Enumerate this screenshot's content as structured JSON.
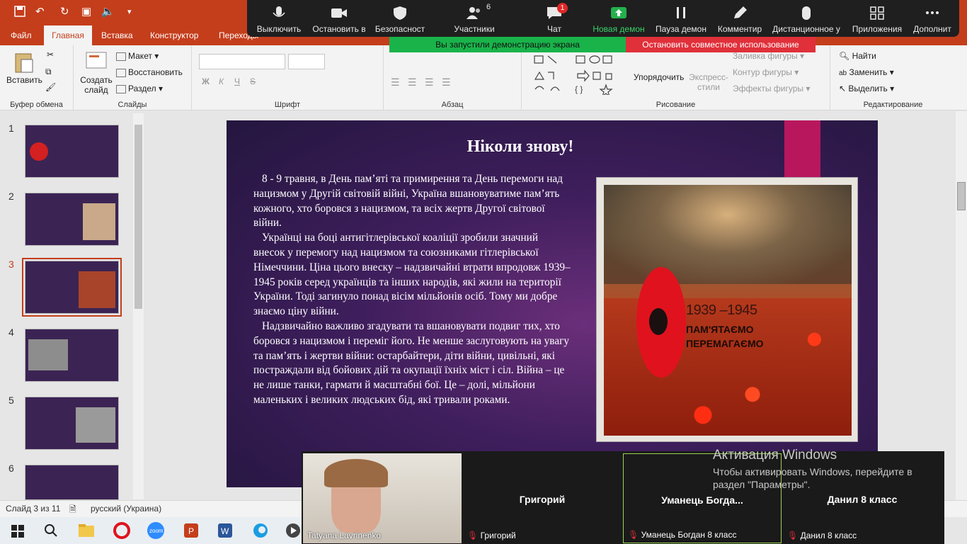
{
  "titlebar": {
    "save_icon": "save-icon",
    "undo_icon": "undo-icon"
  },
  "tabs": [
    {
      "label": "Файл"
    },
    {
      "label": "Главная"
    },
    {
      "label": "Вставка"
    },
    {
      "label": "Конструктор"
    },
    {
      "label": "Переходы"
    }
  ],
  "ribbon": {
    "clipboard": {
      "paste": "Вставить",
      "label": "Буфер обмена"
    },
    "slides": {
      "new_slide": "Создать слайд",
      "layout": "Макет",
      "reset": "Восстановить",
      "section": "Раздел",
      "label": "Слайды"
    },
    "font": {
      "label": "Шрифт",
      "bold": "Ж",
      "italic": "К",
      "underline": "Ч",
      "strike": "S"
    },
    "paragraph": {
      "label": "Абзац"
    },
    "drawing": {
      "arrange": "Упорядочить",
      "quick_styles": "Экспресс-стили",
      "fill": "Заливка фигуры",
      "outline": "Контур фигуры",
      "effects": "Эффекты фигуры",
      "label": "Рисование"
    },
    "editing": {
      "find": "Найти",
      "replace": "Заменить",
      "select": "Выделить",
      "label": "Редактирование"
    }
  },
  "zoom": {
    "buttons": [
      {
        "label": "Выключить",
        "icon": "microphone-icon"
      },
      {
        "label": "Остановить в",
        "icon": "video-camera-icon"
      },
      {
        "label": "Безопасност",
        "icon": "shield-icon"
      },
      {
        "label": "Участники",
        "icon": "participants-icon",
        "count": "6"
      },
      {
        "label": "Чат",
        "icon": "chat-icon",
        "badge": "1"
      },
      {
        "label": "Новая демон",
        "icon": "share-screen-icon"
      },
      {
        "label": "Пауза демон",
        "icon": "pause-icon"
      },
      {
        "label": "Комментир",
        "icon": "annotate-pencil-icon"
      },
      {
        "label": "Дистанционное у",
        "icon": "remote-mouse-icon"
      },
      {
        "label": "Приложения",
        "icon": "apps-icon"
      },
      {
        "label": "Дополнит",
        "icon": "more-icon"
      }
    ],
    "share_banner": "Вы запустили демонстрацию экрана",
    "stop_share": "Остановить совместное использование",
    "videos": [
      {
        "name": "Tatyana Lavrinenko",
        "caption": "Tatyana Lavrinenko",
        "has_video": true
      },
      {
        "name": "Григорий",
        "caption": "Григорий"
      },
      {
        "name": "Уманець  Богда...",
        "caption": "Уманець Богдан 8 класс"
      },
      {
        "name": "Данил 8 класс",
        "caption": "Данил 8 класс"
      }
    ]
  },
  "thumbnails": [
    {
      "num": "1"
    },
    {
      "num": "2"
    },
    {
      "num": "3"
    },
    {
      "num": "4"
    },
    {
      "num": "5"
    },
    {
      "num": "6"
    }
  ],
  "slide": {
    "title": "Ніколи знову!",
    "p1": "8 - 9 травня, в День пам’яті та примирення та День перемоги над нацизмом у Другій світовій війні, Україна вшановуватиме пам’ять кожного, хто боровся з нацизмом, та всіх жертв Другої світової війни.",
    "p2": "Українці на боці антигітлерівської коаліції зробили значний внесок у перемогу над нацизмом та союзниками гітлерівської Німеччини. Ціна цього внеску – надзвичайні втрати впродовж 1939–1945 років серед українців та інших народів, які жили на території України. Тоді загинуло понад вісім мільйонів осіб. Тому ми добре знаємо ціну війни.",
    "p3": "Надзвичайно важливо згадувати та вшановувати подвиг тих, хто боровся з нацизмом і переміг його. Не менше заслуговують на увагу та пам’ять і жертви війни: остарбайтери, діти війни, цивільні, які постраждали від бойових дій та окупації їхніх міст і сіл. Війна – це не лише танки, гармати й масштабні бої. Це – долі, мільйони маленьких і великих людських бід, які тривали роками.",
    "poster_years": "1939 –1945",
    "poster_line1": "ПАМ'ЯТАЄМО",
    "poster_line2": "ПЕРЕМАГАЄМО"
  },
  "status": {
    "slide": "Слайд 3 из 11",
    "language": "русский (Украина)"
  },
  "activation": {
    "title": "Активация Windows",
    "line1": "Чтобы активировать Windows, перейдите в",
    "line2": "раздел \"Параметры\"."
  }
}
